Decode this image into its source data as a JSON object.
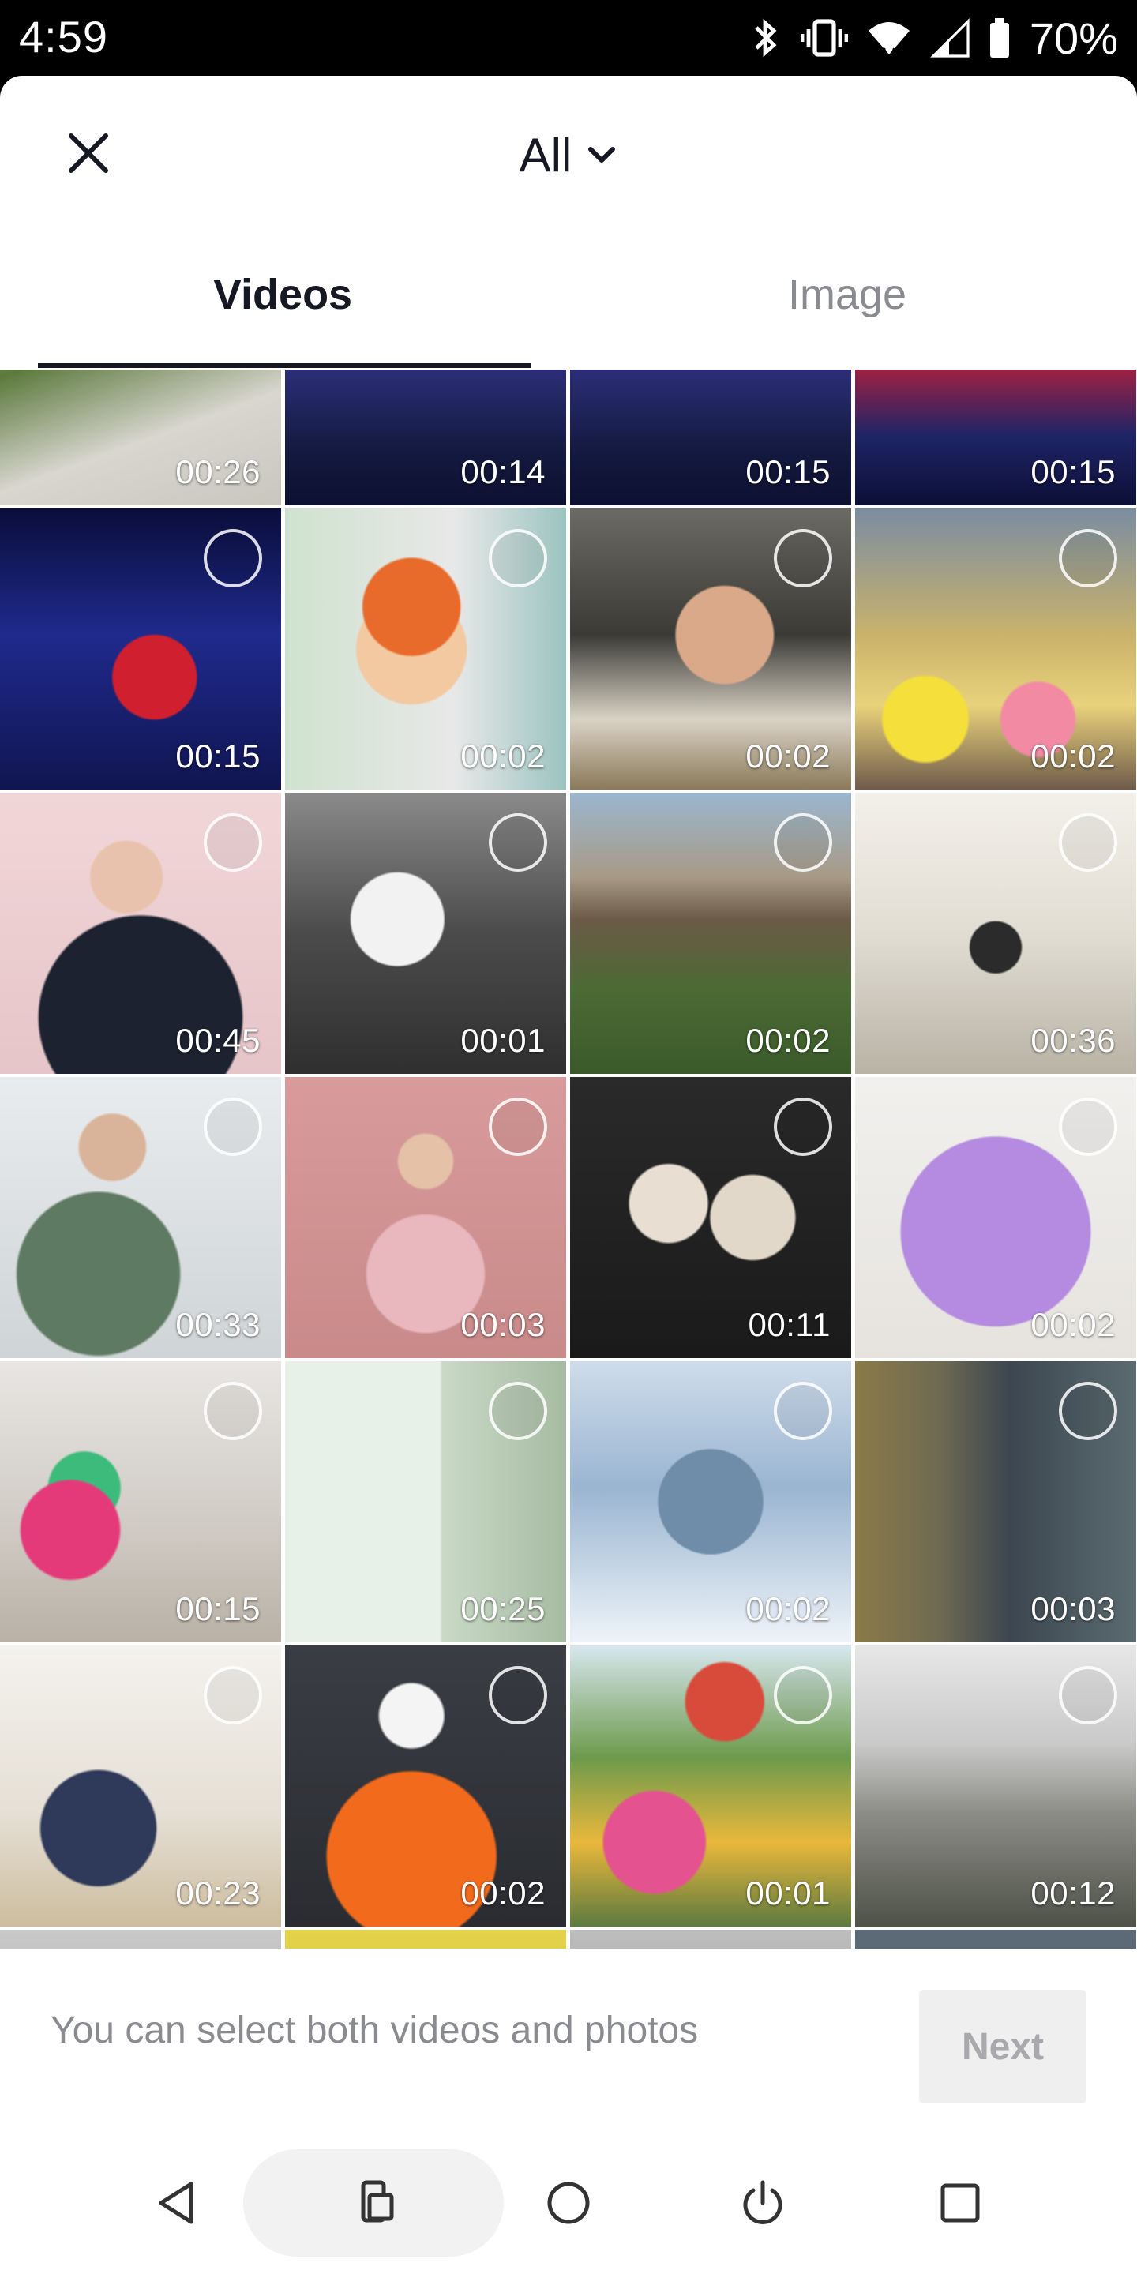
{
  "status_bar": {
    "time": "4:59",
    "battery": "70%"
  },
  "header": {
    "album_label": "All"
  },
  "tabs": [
    {
      "label": "Videos",
      "active": true
    },
    {
      "label": "Image",
      "active": false
    }
  ],
  "grid": {
    "items": [
      {
        "duration": "00:26"
      },
      {
        "duration": "00:14"
      },
      {
        "duration": "00:15"
      },
      {
        "duration": "00:15"
      },
      {
        "duration": "00:15"
      },
      {
        "duration": "00:02"
      },
      {
        "duration": "00:02"
      },
      {
        "duration": "00:02"
      },
      {
        "duration": "00:45"
      },
      {
        "duration": "00:01"
      },
      {
        "duration": "00:02"
      },
      {
        "duration": "00:36"
      },
      {
        "duration": "00:33"
      },
      {
        "duration": "00:03"
      },
      {
        "duration": "00:11"
      },
      {
        "duration": "00:02"
      },
      {
        "duration": "00:15"
      },
      {
        "duration": "00:25"
      },
      {
        "duration": "00:02"
      },
      {
        "duration": "00:03"
      },
      {
        "duration": "00:23"
      },
      {
        "duration": "00:02"
      },
      {
        "duration": "00:01"
      },
      {
        "duration": "00:12"
      }
    ]
  },
  "footer": {
    "hint": "You can select both videos and photos",
    "next_label": "Next"
  },
  "colors": {
    "text_primary": "#161823",
    "text_secondary": "#8a8b91",
    "next_disabled_bg": "#efefef"
  }
}
